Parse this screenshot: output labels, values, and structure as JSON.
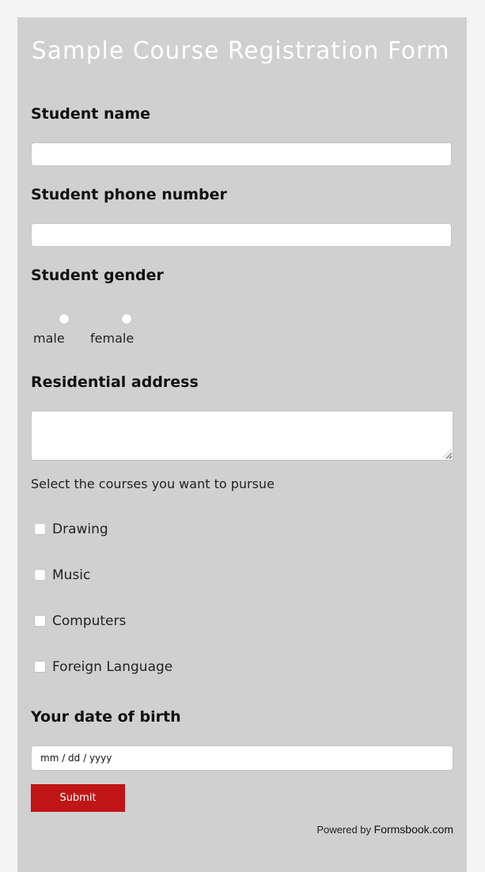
{
  "form": {
    "title": "Sample Course Registration Form",
    "fields": {
      "student_name": {
        "label": "Student name",
        "value": ""
      },
      "phone": {
        "label": "Student phone number",
        "value": ""
      },
      "gender": {
        "label": "Student gender",
        "options": [
          {
            "label": "male",
            "selected": false
          },
          {
            "label": "female",
            "selected": false
          }
        ]
      },
      "address": {
        "label": "Residential address",
        "value": ""
      },
      "courses": {
        "label": "Select the courses you want to pursue",
        "options": [
          {
            "label": "Drawing",
            "checked": false
          },
          {
            "label": "Music",
            "checked": false
          },
          {
            "label": "Computers",
            "checked": false
          },
          {
            "label": "Foreign Language",
            "checked": false
          }
        ]
      },
      "dob": {
        "label": "Your date of birth",
        "placeholder": "mm / dd / yyyy"
      }
    },
    "submit_label": "Submit",
    "footer": {
      "powered_by": "Powered by",
      "brand": "Formsbook.com"
    }
  },
  "colors": {
    "page_bg": "#f4f4f4",
    "card_bg": "#d0d0d0",
    "accent": "#c01517",
    "title": "#ffffff"
  }
}
